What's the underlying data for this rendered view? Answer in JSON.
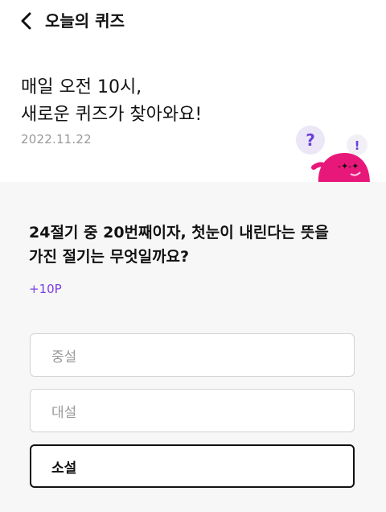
{
  "header": {
    "title": "오늘의 퀴즈",
    "back_icon": "chevron-left-icon"
  },
  "intro": {
    "line1": "매일 오전 10시,",
    "line2": "새로운 퀴즈가 찾아와요!",
    "date": "2022.11.22"
  },
  "mascot": {
    "question_mark": "?",
    "exclamation": "!",
    "body_color": "#e8187a",
    "bubble_color": "#ece7f7"
  },
  "quiz": {
    "question_line1": "24절기 중 20번째이자, 첫눈이 내린다는 뜻을",
    "question_line2": "가진 절기는 무엇일까요?",
    "points": "+10P",
    "options": [
      {
        "label": "중설",
        "selected": false
      },
      {
        "label": "대설",
        "selected": false
      },
      {
        "label": "소설",
        "selected": true
      }
    ]
  },
  "colors": {
    "accent": "#7b3fe4",
    "panel_bg": "#f7f7f7",
    "date_gray": "#999999"
  }
}
